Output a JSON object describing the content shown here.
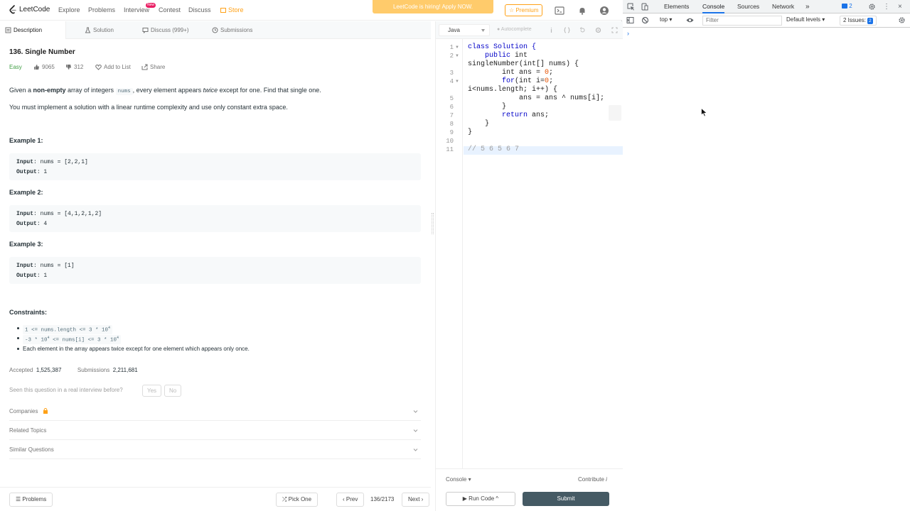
{
  "nav": {
    "logo": "LeetCode",
    "items": [
      "Explore",
      "Problems",
      "Interview",
      "Contest",
      "Discuss",
      "Store"
    ],
    "new_badge": "New",
    "hiring_banner": "LeetCode is hiring! Apply NOW.",
    "premium": "Premium"
  },
  "tabs": [
    "Description",
    "Solution",
    "Discuss (999+)",
    "Submissions"
  ],
  "problem": {
    "title": "136. Single Number",
    "difficulty": "Easy",
    "likes": "9065",
    "dislikes": "312",
    "add_to_list": "Add to List",
    "share": "Share",
    "desc_1a": "Given a ",
    "desc_1b": "non-empty",
    "desc_1c": " array of integers ",
    "desc_1d": "nums",
    "desc_1e": ", every element appears ",
    "desc_1f": "twice",
    "desc_1g": " except for one. Find that single one.",
    "desc_2": "You must implement a solution with a linear runtime complexity and use only constant extra space.",
    "examples": [
      {
        "heading": "Example 1:",
        "input": "nums = [2,2,1]",
        "output": "1"
      },
      {
        "heading": "Example 2:",
        "input": "nums = [4,1,2,1,2]",
        "output": "4"
      },
      {
        "heading": "Example 3:",
        "input": "nums = [1]",
        "output": "1"
      }
    ],
    "input_label": "Input",
    "output_label": "Output",
    "constraints_heading": "Constraints:",
    "constraints": {
      "c1": "1 <= nums.length <= 3 * 10",
      "c1_sup": "4",
      "c2a": "-3 * 10",
      "c2a_sup": "4",
      "c2b": " <= nums[i] <= 3 * 10",
      "c2b_sup": "4",
      "c3": "Each element in the array appears twice except for one element which appears only once."
    },
    "accepted_label": "Accepted",
    "accepted": "1,525,387",
    "submissions_label": "Submissions",
    "submissions": "2,211,681",
    "seen_question": "Seen this question in a real interview before?",
    "yes": "Yes",
    "no": "No",
    "accordions": [
      "Companies",
      "Related Topics",
      "Similar Questions"
    ]
  },
  "bottom": {
    "problems": "Problems",
    "pick_one": "Pick One",
    "prev": "Prev",
    "page": "136/2173",
    "next": "Next"
  },
  "editor": {
    "language": "Java",
    "autocomplete": "Autocomplete",
    "line_numbers": [
      "1",
      "2",
      "",
      "3",
      "4",
      "",
      "5",
      "6",
      "7",
      "8",
      "9",
      "10",
      "11"
    ],
    "code": {
      "l1a": "class ",
      "l1b": "Solution {",
      "l2a": "    public ",
      "l2b": "int",
      "l2c": "singleNumber(int[] nums) {",
      "l3a": "        int ans = ",
      "l3b": "0",
      "l3c": ";",
      "l4a": "        ",
      "l4b": "for",
      "l4c": "(int i=",
      "l4d": "0",
      "l4e": ";",
      "l4f": "i<nums.length; i++) {",
      "l5": "            ans = ans ^ nums[i];",
      "l6": "        }",
      "l7a": "        ",
      "l7b": "return",
      "l7c": " ans;",
      "l8": "    }",
      "l9": "}",
      "l11": "// 5 6 5 6 7"
    },
    "console": "Console",
    "contribute": "Contribute",
    "run_code": "Run Code",
    "submit": "Submit"
  },
  "devtools": {
    "tabs": [
      "Elements",
      "Console",
      "Sources",
      "Network"
    ],
    "badge_count": "2",
    "context": "top",
    "filter_placeholder": "Filter",
    "levels": "Default levels",
    "issues": "2 Issues:",
    "issues_count": "2"
  },
  "colors": {
    "accent": "#ffa116",
    "easy": "#43a047",
    "submit_bg": "#455a64",
    "devtools_blue": "#1a73e8"
  }
}
